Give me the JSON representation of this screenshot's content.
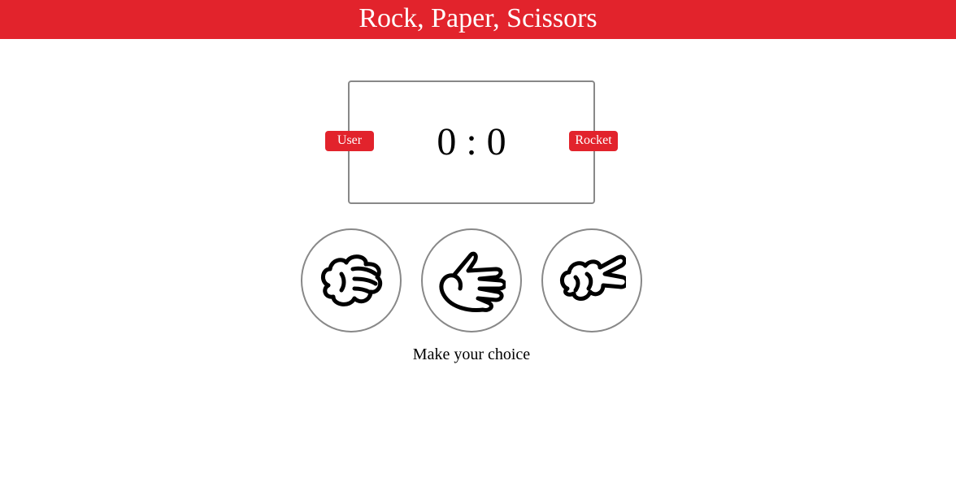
{
  "header": {
    "title": "Rock, Paper, Scissors"
  },
  "scoreboard": {
    "user_label": "User",
    "computer_label": "Rocket",
    "user_score": "0",
    "separator": ":",
    "computer_score": "0",
    "score_text": "0 : 0"
  },
  "choices": [
    {
      "name": "rock",
      "icon": "rock-hand-icon"
    },
    {
      "name": "paper",
      "icon": "paper-hand-icon"
    },
    {
      "name": "scissors",
      "icon": "scissors-hand-icon"
    }
  ],
  "result": {
    "message": "Make your choice"
  },
  "colors": {
    "accent": "#e2232c",
    "border": "#888888"
  }
}
